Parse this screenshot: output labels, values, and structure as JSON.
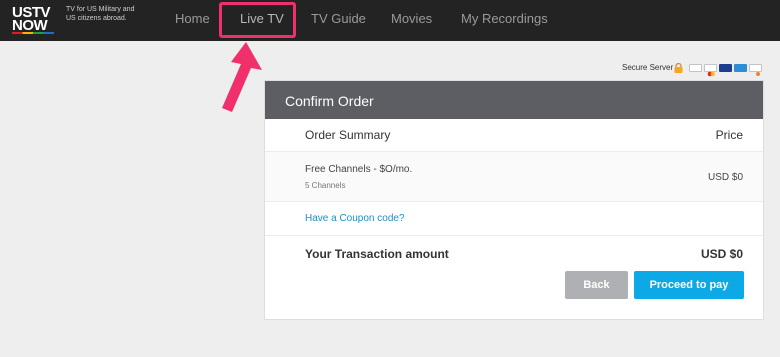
{
  "brand": {
    "logo_top": "USTV",
    "logo_bottom": "NOW",
    "tagline": "TV for US Military and US citizens abroad."
  },
  "nav": {
    "items": [
      {
        "label": "Home"
      },
      {
        "label": "Live TV"
      },
      {
        "label": "TV Guide"
      },
      {
        "label": "Movies"
      },
      {
        "label": "My Recordings"
      }
    ]
  },
  "security": {
    "label": "Secure Server",
    "icon": "lock-icon",
    "payment_icons": [
      "paypal-icon",
      "mastercard-icon",
      "visa-icon",
      "amex-icon",
      "discover-icon"
    ]
  },
  "order": {
    "title": "Confirm Order",
    "summary_label": "Order Summary",
    "price_label": "Price",
    "item": {
      "name": "Free Channels - $O/mo.",
      "sub": "5 Channels",
      "price": "USD $0"
    },
    "coupon_link": "Have a Coupon code?",
    "total_label": "Your Transaction amount",
    "total_value": "USD $0",
    "back_label": "Back",
    "proceed_label": "Proceed to pay"
  },
  "colors": {
    "header_bg": "#232323",
    "highlight": "#f0306a",
    "panel_header": "#5c5e63",
    "accent": "#0ca9e6",
    "link": "#1a8fc9",
    "back_button": "#aeb0b3"
  }
}
